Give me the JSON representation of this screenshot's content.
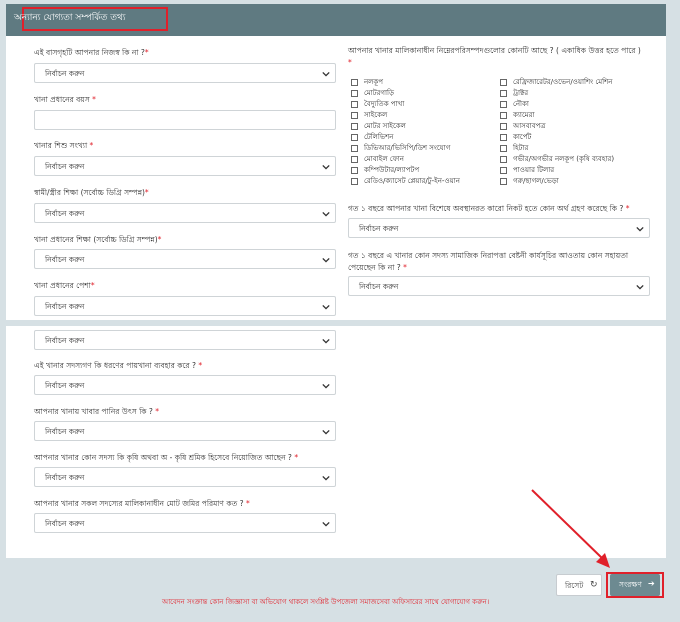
{
  "header": {
    "title": "অন্যান্য যোগ্যতা সম্পর্কিত তথ্য"
  },
  "placeholder": "নির্বাচন করুন",
  "req": "*",
  "left_q": [
    "এই বাসগৃহটি আপনার নিজস্ব কি না ?",
    "খানা প্রধানের বয়স",
    "খানার শিশু সংখ্যা",
    "স্বামী/স্ত্রীর শিক্ষা (সর্বোচ্চ ডিগ্রি সম্পন্ন)",
    "খানা প্রধানের শিক্ষা (সর্বোচ্চ ডিগ্রি সম্পন্ন)",
    "খানা প্রধানের পেশা"
  ],
  "left_q2": [
    "এই খানার সদস্যগণ কি ধরণের পায়খানা ব্যবহার করে ?",
    "আপনার খানায় খাবার পানির উৎস কি ?",
    "আপনার খানার কোন সদস্য কি কৃষি অথবা অ - কৃষি শ্রমিক হিসেবে নিয়োজিত আছেন ?",
    "আপনার খানার সকল সদস্যের মালিকানাধীন মোট জমির পরিমাণ কত ?"
  ],
  "assets": {
    "question": "আপনার খানার মালিকানাধীন নিম্নেরপরিসম্পদগুলোর কোনটি আছে ? ( একাধিক উত্তর হতে পারে )",
    "col1": [
      "নলকূপ",
      "মোটরগাড়ি",
      "বৈদ্যুতিক পাখা",
      "সাইকেল",
      "মোটর সাইকেল",
      "টেলিভিশন",
      "ডিভিআর/ভিসিপি/ডিশ সংযোগ",
      "মোবাইল ফোন",
      "কম্পিউটার/ল্যাপটপ",
      "রেডিও/ক্যাসেট প্লেয়ার/টু-ইন-ওয়ান"
    ],
    "col2": [
      "রেফ্রিজারেটর/ওভেন/ওয়াশিং মেশিন",
      "ট্রাক্টর",
      "নৌকা",
      "ক্যামেরা",
      "আসবাবপত্র",
      "কার্পেট",
      "হিটার",
      "গভীর/অগভীর নলকূপ (কৃষি ব্যবহার)",
      "পাওয়ার টিলার",
      "গরু/ছাগল/ভেড়া"
    ]
  },
  "right_q": [
    "গত ১ বছরে আপনার খানা বিশেষে অবস্থানরত কারো নিকট হতে কোন অর্থ গ্রহণ করেছে কি ?",
    "গত ১ বছরে এ খানার কোন সদস্য সামাজিক নিরাপত্তা বেষ্টনী কার্যসূচির আওতায় কোন সহায়তা",
    "পেয়েছেন কি না ?"
  ],
  "buttons": {
    "reset": "রিসেট",
    "save": "সংরক্ষণ"
  },
  "note": "আবেদন সংক্রান্ত কোন জিজ্ঞাসা বা অভিযোগ থাকলে সংশ্লিষ্ট উপজেলা সমাজসেবা অফিসারের সাথে যোগাযোগ করুন।"
}
